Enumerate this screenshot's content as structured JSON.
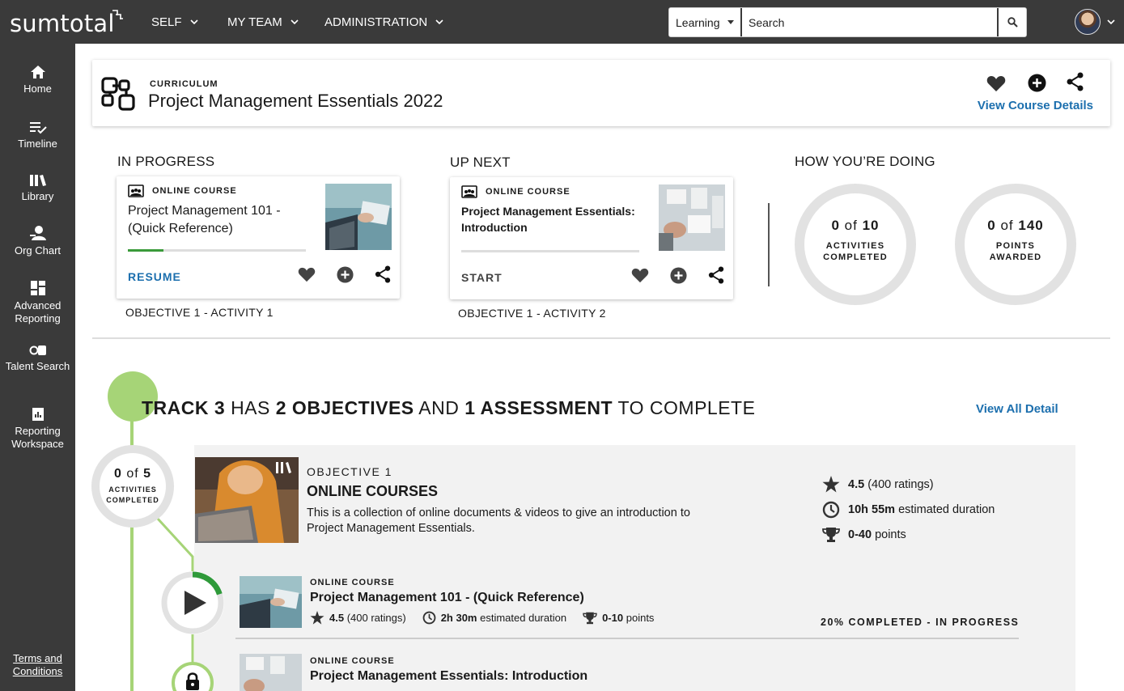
{
  "app": {
    "logo": "sumtotal",
    "nav": [
      "SELF",
      "MY TEAM",
      "ADMINISTRATION"
    ],
    "search_scope": "Learning",
    "search_placeholder": "Search"
  },
  "sidebar": {
    "items": [
      {
        "label": "Home",
        "icon": "home-icon"
      },
      {
        "label": "Timeline",
        "icon": "timeline-icon"
      },
      {
        "label": "Library",
        "icon": "library-icon"
      },
      {
        "label": "Org Chart",
        "icon": "org-chart-icon"
      },
      {
        "label": "Advanced Reporting",
        "icon": "dashboard-icon"
      },
      {
        "label": "Talent Search",
        "icon": "talent-search-icon"
      },
      {
        "label": "Reporting Workspace",
        "icon": "report-icon"
      }
    ],
    "terms": "Terms and Conditions"
  },
  "header": {
    "type_label": "CURRICULUM",
    "title": "Project Management Essentials 2022",
    "view_details": "View Course Details"
  },
  "in_progress": {
    "section": "IN PROGRESS",
    "type": "ONLINE COURSE",
    "title": "Project Management 101 - (Quick Reference)",
    "progress": 0.2,
    "action": "RESUME",
    "caption": "OBJECTIVE 1 - ACTIVITY 1"
  },
  "up_next": {
    "section": "UP NEXT",
    "type": "ONLINE COURSE",
    "title": "Project Management Essentials: Introduction",
    "progress": 0,
    "action": "START",
    "caption": "OBJECTIVE 1 - ACTIVITY 2"
  },
  "doing": {
    "section": "HOW YOU’RE DOING",
    "activities": {
      "done": "0",
      "of": "of",
      "total": "10",
      "label1": "ACTIVITIES",
      "label2": "COMPLETED"
    },
    "points": {
      "done": "0",
      "of": "of",
      "total": "140",
      "label1": "POINTS",
      "label2": "AWARDED"
    }
  },
  "track": {
    "name": "TRACK 3",
    "has": "HAS",
    "objectives": "2 OBJECTIVES",
    "and": "AND",
    "assessment": "1 ASSESSMENT",
    "tail": "TO COMPLETE",
    "view_all": "View All Detail"
  },
  "objective": {
    "ring": {
      "done": "0",
      "of": "of",
      "total": "5",
      "label1": "ACTIVITIES",
      "label2": "COMPLETED"
    },
    "number": "OBJECTIVE 1",
    "title": "ONLINE COURSES",
    "description": "This is a collection of online documents & videos to give an introduction to Project Management Essentials.",
    "rating": "4.5",
    "rating_count": "(400 ratings)",
    "duration": "10h 55m",
    "duration_label": "estimated duration",
    "points": "0-40",
    "points_label": "points"
  },
  "items": [
    {
      "type": "ONLINE COURSE",
      "title": "Project Management 101 - (Quick Reference)",
      "rating": "4.5",
      "rating_count": "(400 ratings)",
      "duration": "2h 30m",
      "duration_label": "estimated duration",
      "points": "0-10",
      "points_label": "points",
      "status": "20% COMPLETED - IN PROGRESS",
      "progress": 0.2
    },
    {
      "type": "ONLINE COURSE",
      "title": "Project Management Essentials: Introduction"
    }
  ],
  "colors": {
    "topbar": "#3a3a3a",
    "link": "#1c6fae",
    "track": "#a6d477",
    "progress": "#3a9a3a"
  }
}
